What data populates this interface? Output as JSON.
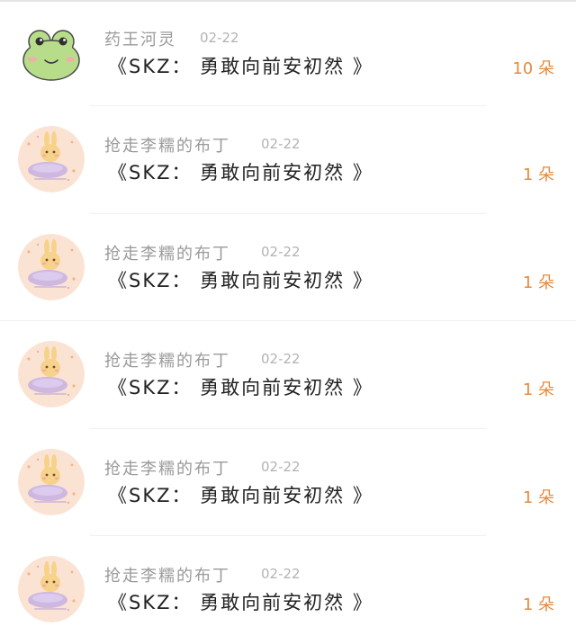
{
  "colors": {
    "name": "#9a9a9a",
    "date": "#b3b3b3",
    "title": "#222222",
    "reward": "#e8893a"
  },
  "items": [
    {
      "avatar_icon": "frog-avatar-icon",
      "name": "药王河灵",
      "date": "02-22",
      "title": "《SKZ： 勇敢向前安初然 》",
      "reward": "10 朵"
    },
    {
      "avatar_icon": "bunny-avatar-icon",
      "name": "抢走李糯的布丁",
      "date": "02-22",
      "title": "《SKZ： 勇敢向前安初然 》",
      "reward": "1 朵"
    },
    {
      "avatar_icon": "bunny-avatar-icon",
      "name": "抢走李糯的布丁",
      "date": "02-22",
      "title": "《SKZ： 勇敢向前安初然 》",
      "reward": "1 朵"
    },
    {
      "avatar_icon": "bunny-avatar-icon",
      "name": "抢走李糯的布丁",
      "date": "02-22",
      "title": "《SKZ： 勇敢向前安初然 》",
      "reward": "1 朵"
    },
    {
      "avatar_icon": "bunny-avatar-icon",
      "name": "抢走李糯的布丁",
      "date": "02-22",
      "title": "《SKZ： 勇敢向前安初然 》",
      "reward": "1 朵"
    },
    {
      "avatar_icon": "bunny-avatar-icon",
      "name": "抢走李糯的布丁",
      "date": "02-22",
      "title": "《SKZ： 勇敢向前安初然 》",
      "reward": "1 朵"
    }
  ]
}
